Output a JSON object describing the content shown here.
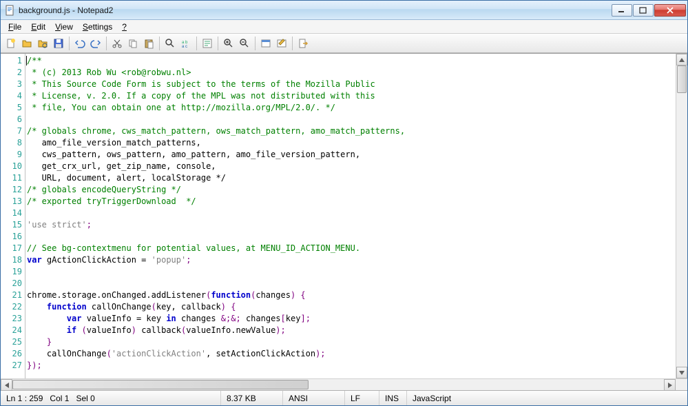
{
  "title": "background.js - Notepad2",
  "menu": {
    "file": "File",
    "edit": "Edit",
    "view": "View",
    "settings": "Settings",
    "help": "?"
  },
  "code_lines": [
    "/**",
    " * (c) 2013 Rob Wu <rob@robwu.nl>",
    " * This Source Code Form is subject to the terms of the Mozilla Public",
    " * License, v. 2.0. If a copy of the MPL was not distributed with this",
    " * file, You can obtain one at http://mozilla.org/MPL/2.0/. */",
    "",
    "/* globals chrome, cws_match_pattern, ows_match_pattern, amo_match_patterns,",
    "   amo_file_version_match_patterns,",
    "   cws_pattern, ows_pattern, amo_pattern, amo_file_version_pattern,",
    "   get_crx_url, get_zip_name, console,",
    "   URL, document, alert, localStorage */",
    "/* globals encodeQueryString */",
    "/* exported tryTriggerDownload  */",
    "",
    "'use strict';",
    "",
    "// See bg-contextmenu for potential values, at MENU_ID_ACTION_MENU.",
    "var gActionClickAction = 'popup';",
    "",
    "",
    "chrome.storage.onChanged.addListener(function(changes) {",
    "    function callOnChange(key, callback) {",
    "        var valueInfo = key in changes && changes[key];",
    "        if (valueInfo) callback(valueInfo.newValue);",
    "    }",
    "    callOnChange('actionClickAction', setActionClickAction);",
    "});"
  ],
  "status": {
    "pos": "Ln 1 : 259",
    "col": "Col 1",
    "sel": "Sel 0",
    "size": "8.37 KB",
    "enc": "ANSI",
    "eol": "LF",
    "mode": "INS",
    "lang": "JavaScript"
  }
}
